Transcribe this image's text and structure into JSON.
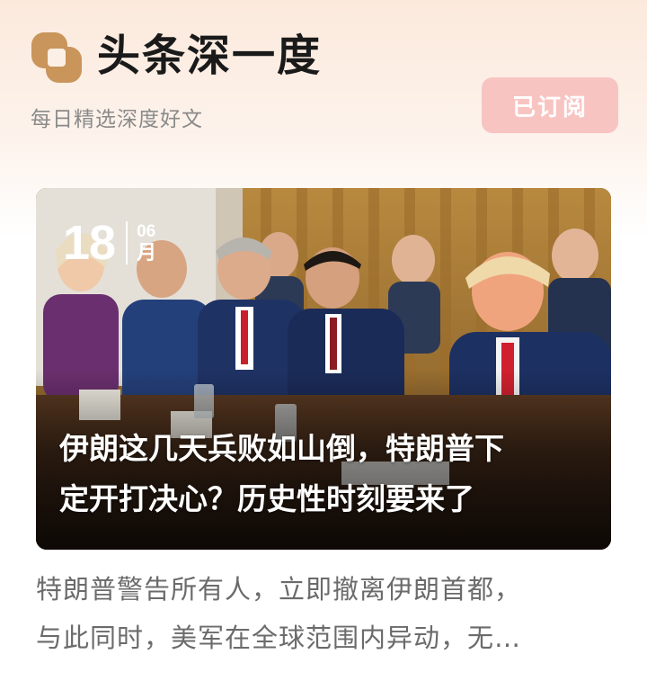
{
  "header": {
    "brand_title": "头条深一度",
    "brand_subtitle": "每日精选深度好文",
    "subscribe_label": "已订阅"
  },
  "article": {
    "date_day": "18",
    "date_month_num": "06",
    "date_month_unit": "月",
    "title_lines": [
      "伊朗这几天兵败如山倒，特朗普下",
      "定开打决心？历史性时刻要来了"
    ],
    "summary_lines": [
      "特朗普警告所有人，立即撤离伊朗首都，",
      "与此同时，美军在全球范围内异动，无…"
    ]
  },
  "colors": {
    "logo_mark": "#c9955a",
    "subscribe_bg": "#f8c4c2",
    "subtitle": "#8a8a8a",
    "summary_text": "#6b6b6b"
  }
}
